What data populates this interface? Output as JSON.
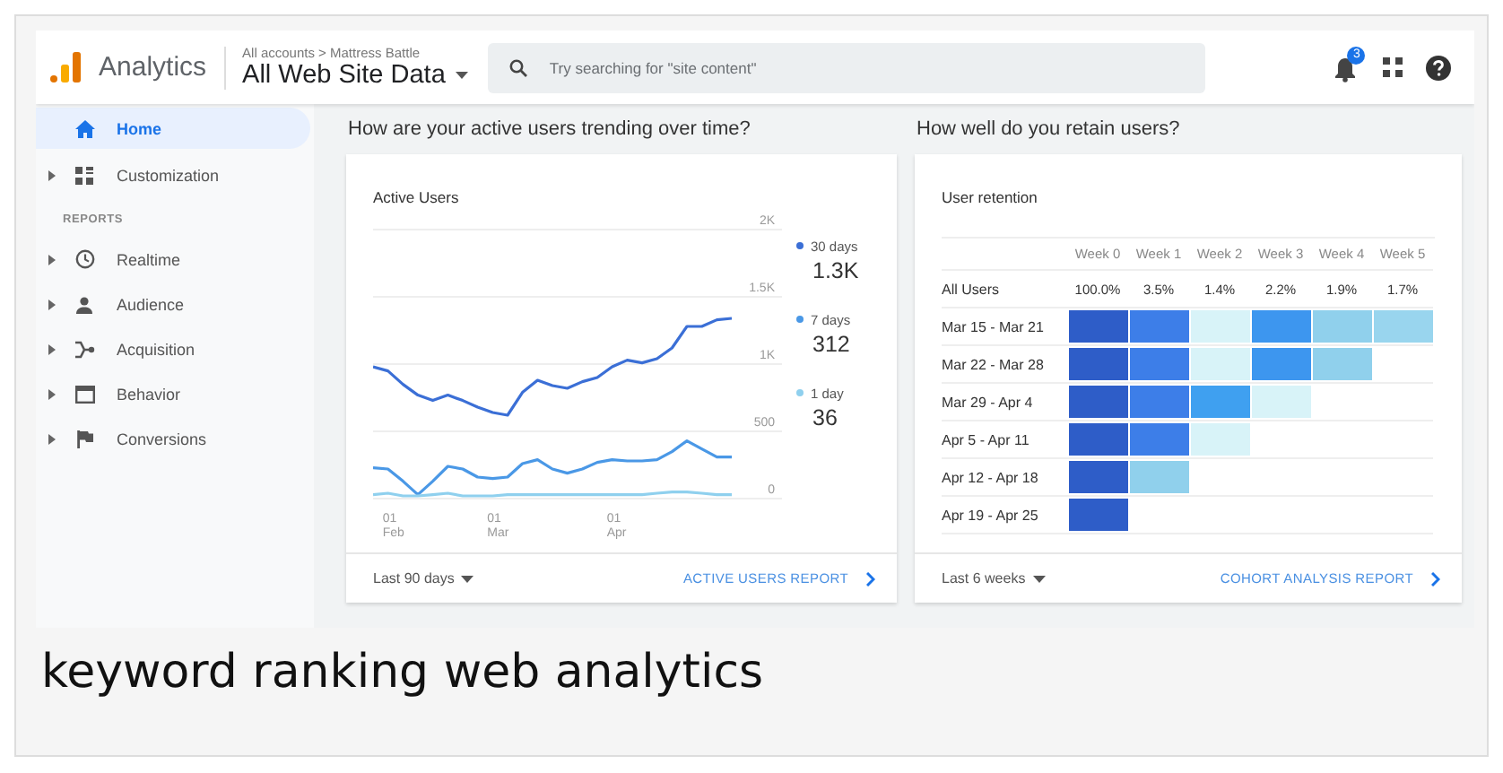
{
  "header": {
    "product": "Analytics",
    "breadcrumb": "All accounts > Mattress Battle",
    "property": "All Web Site Data",
    "search": {
      "placeholder": "Try searching for \"site content\""
    },
    "notification_count": "3"
  },
  "sidebar": {
    "items": [
      {
        "kind": "item",
        "label": "Home",
        "selected": true,
        "expandable": false
      },
      {
        "kind": "item",
        "label": "Customization",
        "selected": false,
        "expandable": true
      },
      {
        "kind": "heading",
        "label": "REPORTS"
      },
      {
        "kind": "item",
        "label": "Realtime",
        "selected": false,
        "expandable": true
      },
      {
        "kind": "item",
        "label": "Audience",
        "selected": false,
        "expandable": true
      },
      {
        "kind": "item",
        "label": "Acquisition",
        "selected": false,
        "expandable": true
      },
      {
        "kind": "item",
        "label": "Behavior",
        "selected": false,
        "expandable": true
      },
      {
        "kind": "item",
        "label": "Conversions",
        "selected": false,
        "expandable": true
      }
    ]
  },
  "active_users": {
    "question": "How are your active users trending over time?",
    "title": "Active Users",
    "chart_data": {
      "type": "line",
      "categories": [
        null,
        "01 Feb",
        null,
        null,
        null,
        null,
        null,
        null,
        "01 Mar",
        null,
        null,
        null,
        null,
        null,
        null,
        null,
        "01 Apr",
        null,
        null,
        null,
        null,
        null,
        null,
        null,
        null
      ],
      "ylim": [
        0,
        2000
      ],
      "grid": true,
      "series": [
        {
          "name": "30 days",
          "color": "#3b6fd6",
          "values": [
            980,
            950,
            850,
            770,
            730,
            770,
            730,
            680,
            640,
            620,
            790,
            880,
            840,
            820,
            870,
            900,
            980,
            1030,
            1010,
            1040,
            1120,
            1280,
            1280,
            1330,
            1340
          ]
        },
        {
          "name": "7 days",
          "color": "#4a98e6",
          "values": [
            230,
            220,
            130,
            30,
            130,
            240,
            220,
            160,
            150,
            160,
            260,
            290,
            220,
            190,
            220,
            270,
            290,
            280,
            280,
            290,
            350,
            430,
            370,
            310,
            310
          ]
        },
        {
          "name": "1 day",
          "color": "#8fd0ee",
          "values": [
            30,
            40,
            20,
            20,
            30,
            40,
            20,
            20,
            20,
            30,
            30,
            30,
            30,
            30,
            30,
            30,
            30,
            30,
            30,
            40,
            50,
            50,
            40,
            30,
            30
          ]
        }
      ],
      "yticks": [
        {
          "value": 0,
          "label": "0"
        },
        {
          "value": 500,
          "label": "500"
        },
        {
          "value": 1000,
          "label": "1K"
        },
        {
          "value": 1500,
          "label": "1.5K"
        },
        {
          "value": 2000,
          "label": "2K"
        }
      ]
    },
    "legend_totals": [
      "1.3K",
      "312",
      "36"
    ],
    "range": "Last 90 days",
    "link": "ACTIVE USERS REPORT"
  },
  "retention": {
    "question": "How well do you retain users?",
    "title": "User retention",
    "columns": [
      "Week 0",
      "Week 1",
      "Week 2",
      "Week 3",
      "Week 4",
      "Week 5"
    ],
    "summary": {
      "label": "All Users",
      "values": [
        "100.0%",
        "3.5%",
        "1.4%",
        "2.2%",
        "1.9%",
        "1.7%"
      ]
    },
    "rows": [
      {
        "label": "Mar 15 - Mar 21",
        "cells": [
          {
            "color": "#2e5dc8"
          },
          {
            "color": "#3d7ee8"
          },
          {
            "color": "#d8f3f8"
          },
          {
            "color": "#3d96ef"
          },
          {
            "color": "#90d0ec"
          },
          {
            "color": "#99d5ee"
          }
        ]
      },
      {
        "label": "Mar 22 - Mar 28",
        "cells": [
          {
            "color": "#2e5dc8"
          },
          {
            "color": "#3d7ee8"
          },
          {
            "color": "#d8f3f8"
          },
          {
            "color": "#3d96ef"
          },
          {
            "color": "#90d0ec"
          }
        ]
      },
      {
        "label": "Mar 29 - Apr 4",
        "cells": [
          {
            "color": "#2e5dc8"
          },
          {
            "color": "#3d7ee8"
          },
          {
            "color": "#3fa0f0"
          },
          {
            "color": "#d8f3f8"
          }
        ]
      },
      {
        "label": "Apr 5 - Apr 11",
        "cells": [
          {
            "color": "#2e5dc8"
          },
          {
            "color": "#3d7ee8"
          },
          {
            "color": "#d8f3f8"
          }
        ]
      },
      {
        "label": "Apr 12 - Apr 18",
        "cells": [
          {
            "color": "#2e5dc8"
          },
          {
            "color": "#90d0ec"
          }
        ]
      },
      {
        "label": "Apr 19 - Apr 25",
        "cells": [
          {
            "color": "#2e5dc8"
          }
        ]
      }
    ],
    "range": "Last 6 weeks",
    "link": "COHORT ANALYSIS REPORT"
  },
  "caption": "keyword ranking web analytics"
}
